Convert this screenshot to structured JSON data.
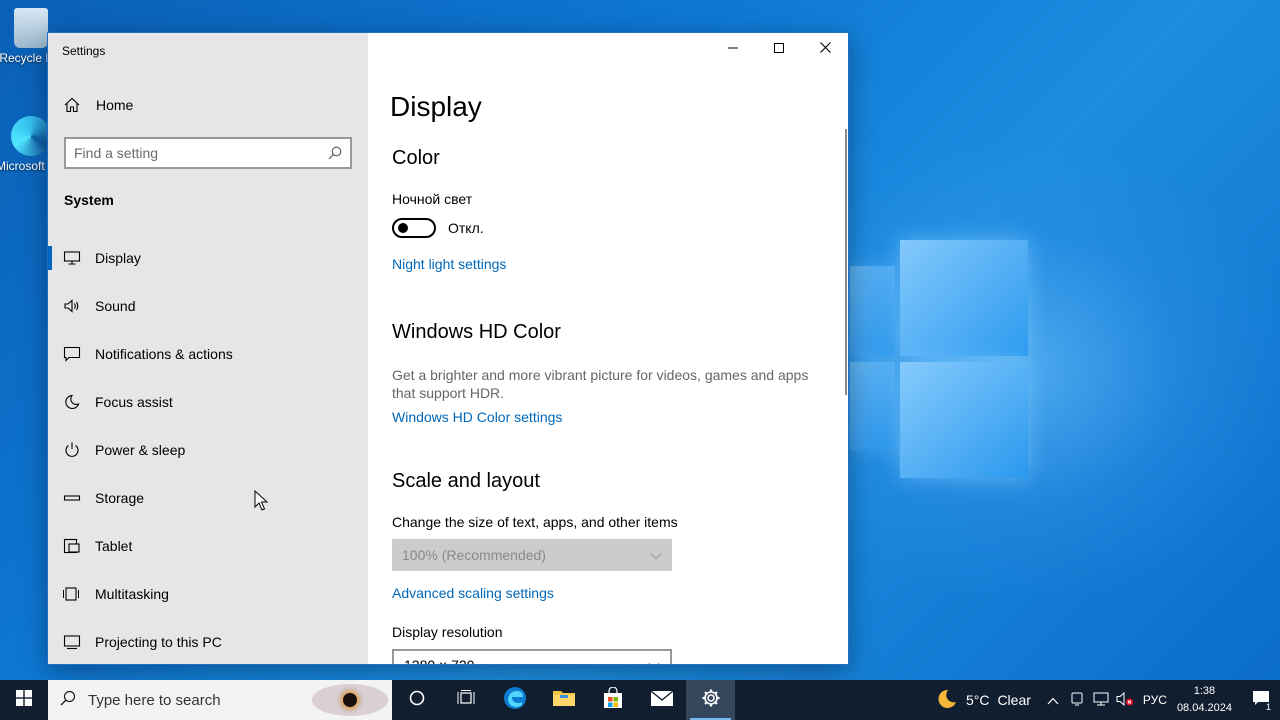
{
  "desktop": {
    "icons": [
      {
        "label": "Recycle Bin"
      },
      {
        "label": "Microsoft Edge"
      }
    ]
  },
  "window": {
    "title": "Settings",
    "controls": {
      "minimize": "minimize-icon",
      "maximize": "maximize-icon",
      "close": "close-icon"
    }
  },
  "sidebar": {
    "home_label": "Home",
    "search_placeholder": "Find a setting",
    "section": "System",
    "items": [
      {
        "label": "Display",
        "icon": "monitor-icon",
        "selected": true
      },
      {
        "label": "Sound",
        "icon": "speaker-icon"
      },
      {
        "label": "Notifications & actions",
        "icon": "notification-icon"
      },
      {
        "label": "Focus assist",
        "icon": "moon-icon"
      },
      {
        "label": "Power & sleep",
        "icon": "power-icon"
      },
      {
        "label": "Storage",
        "icon": "storage-icon"
      },
      {
        "label": "Tablet",
        "icon": "tablet-icon"
      },
      {
        "label": "Multitasking",
        "icon": "multitasking-icon"
      },
      {
        "label": "Projecting to this PC",
        "icon": "projector-icon"
      }
    ]
  },
  "content": {
    "title": "Display",
    "color": {
      "heading": "Color",
      "night_light_label": "Ночной свет",
      "toggle_state": "Откл.",
      "link": "Night light settings"
    },
    "hd_color": {
      "heading": "Windows HD Color",
      "description": "Get a brighter and more vibrant picture for videos, games and apps that support HDR.",
      "link": "Windows HD Color settings"
    },
    "scale": {
      "heading": "Scale and layout",
      "size_label": "Change the size of text, apps, and other items",
      "size_value": "100% (Recommended)",
      "advanced_link": "Advanced scaling settings",
      "resolution_label": "Display resolution",
      "resolution_value": "1280 × 720"
    }
  },
  "taskbar": {
    "search_placeholder": "Type here to search",
    "apps": [
      "task-view",
      "edge",
      "file-explorer",
      "store",
      "mail",
      "settings"
    ],
    "weather": {
      "temp": "5°C",
      "condition": "Clear"
    },
    "language": "РУС",
    "time": "1:38",
    "date": "08.04.2024",
    "notification_count": "1"
  },
  "colors": {
    "accent": "#0067c0",
    "link": "#0067b8",
    "taskbar": "#101e30",
    "sidebar": "#e6e6e6"
  }
}
